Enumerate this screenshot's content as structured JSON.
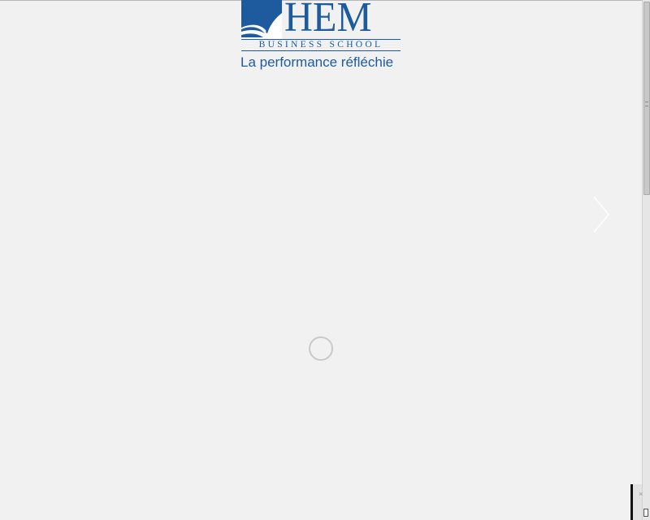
{
  "logo": {
    "wordmark": "HEM",
    "subtitle": "BUSINESS SCHOOL",
    "tagline": "La performance réfléchie",
    "brand_color": "#1d5b9e"
  },
  "slider": {
    "next_icon": "chevron-right-icon",
    "loading_icon": "loading-spinner-icon"
  },
  "widget": {
    "close_label": "×"
  },
  "colors": {
    "background": "#f1f1f1",
    "spinner": "#c9c9c9",
    "arrow": "#ffffff"
  }
}
